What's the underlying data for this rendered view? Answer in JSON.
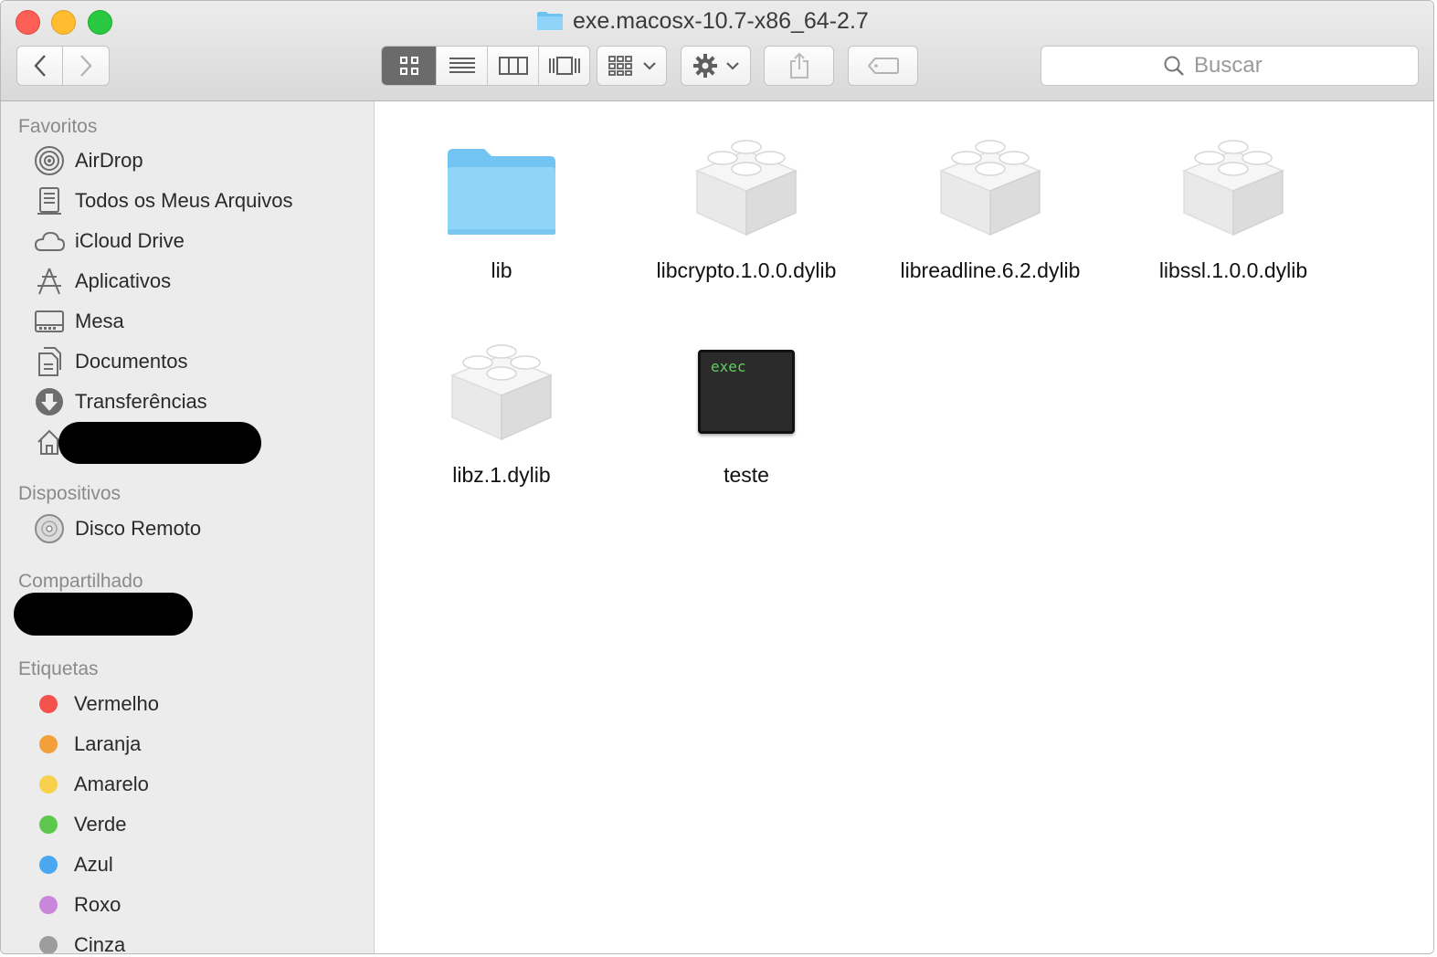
{
  "window": {
    "title": "exe.macosx-10.7-x86_64-2.7"
  },
  "search": {
    "placeholder": "Buscar"
  },
  "sidebar": {
    "favorites_header": "Favoritos",
    "favorites": [
      {
        "label": "AirDrop",
        "icon": "airdrop-icon"
      },
      {
        "label": "Todos os Meus Arquivos",
        "icon": "all-files-icon"
      },
      {
        "label": "iCloud Drive",
        "icon": "icloud-icon"
      },
      {
        "label": "Aplicativos",
        "icon": "applications-icon"
      },
      {
        "label": "Mesa",
        "icon": "desktop-icon"
      },
      {
        "label": "Documentos",
        "icon": "documents-icon"
      },
      {
        "label": "Transferências",
        "icon": "downloads-icon"
      }
    ],
    "devices_header": "Dispositivos",
    "devices": [
      {
        "label": "Disco Remoto",
        "icon": "disc-icon"
      }
    ],
    "shared_header": "Compartilhado",
    "tags_header": "Etiquetas",
    "tags": [
      {
        "label": "Vermelho",
        "color": "#f4524d"
      },
      {
        "label": "Laranja",
        "color": "#f4a03a"
      },
      {
        "label": "Amarelo",
        "color": "#f7d14c"
      },
      {
        "label": "Verde",
        "color": "#5ec84e"
      },
      {
        "label": "Azul",
        "color": "#4aa8f0"
      },
      {
        "label": "Roxo",
        "color": "#c987dc"
      },
      {
        "label": "Cinza",
        "color": "#9d9d9d"
      }
    ]
  },
  "files": [
    {
      "name": "lib",
      "kind": "folder"
    },
    {
      "name": "libcrypto.1.0.0.dylib",
      "kind": "dylib"
    },
    {
      "name": "libreadline.6.2.dylib",
      "kind": "dylib"
    },
    {
      "name": "libssl.1.0.0.dylib",
      "kind": "dylib"
    },
    {
      "name": "libz.1.dylib",
      "kind": "dylib"
    },
    {
      "name": "teste",
      "kind": "exec",
      "exec_label": "exec"
    }
  ]
}
